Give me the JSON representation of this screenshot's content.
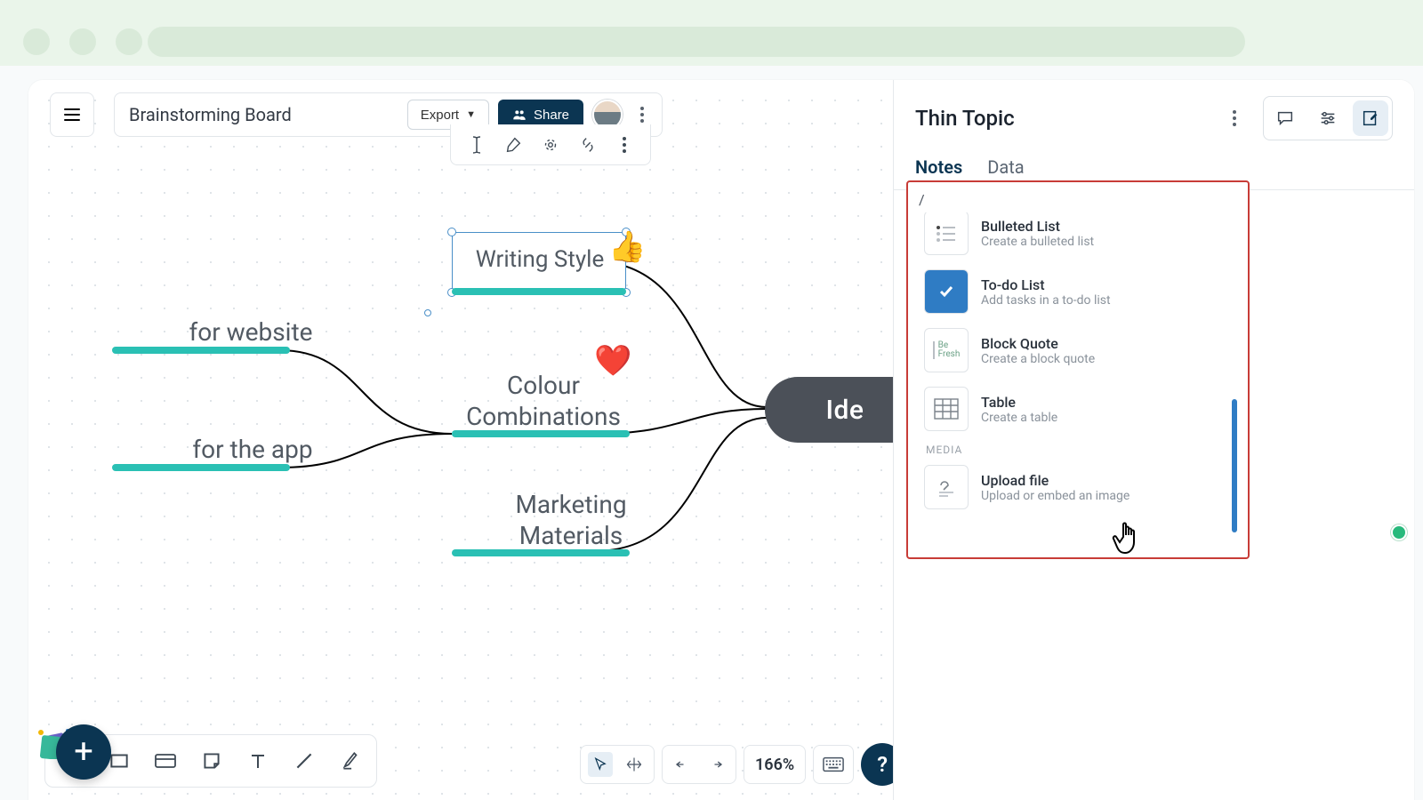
{
  "header": {
    "board_title": "Brainstorming Board",
    "export_label": "Export",
    "share_label": "Share"
  },
  "mindmap": {
    "center": "Ide",
    "nodes": {
      "writing_style": "Writing Style",
      "colour_combinations_line1": "Colour",
      "colour_combinations_line2": "Combinations",
      "marketing_line1": "Marketing",
      "marketing_line2": "Materials",
      "for_website": "for website",
      "for_the_app": "for the app"
    }
  },
  "view": {
    "zoom": "166%"
  },
  "side_panel": {
    "title": "Thin Topic",
    "tabs": {
      "notes": "Notes",
      "data": "Data"
    },
    "slash_input": "/",
    "media_section": "MEDIA",
    "items": [
      {
        "title": "Bulleted List",
        "desc": "Create a bulleted list"
      },
      {
        "title": "To-do List",
        "desc": "Add tasks in a to-do list"
      },
      {
        "title": "Block Quote",
        "desc": "Create a block quote"
      },
      {
        "title": "Table",
        "desc": "Create a table"
      }
    ],
    "media_items": [
      {
        "title": "Upload file",
        "desc": "Upload or embed an image"
      }
    ]
  }
}
